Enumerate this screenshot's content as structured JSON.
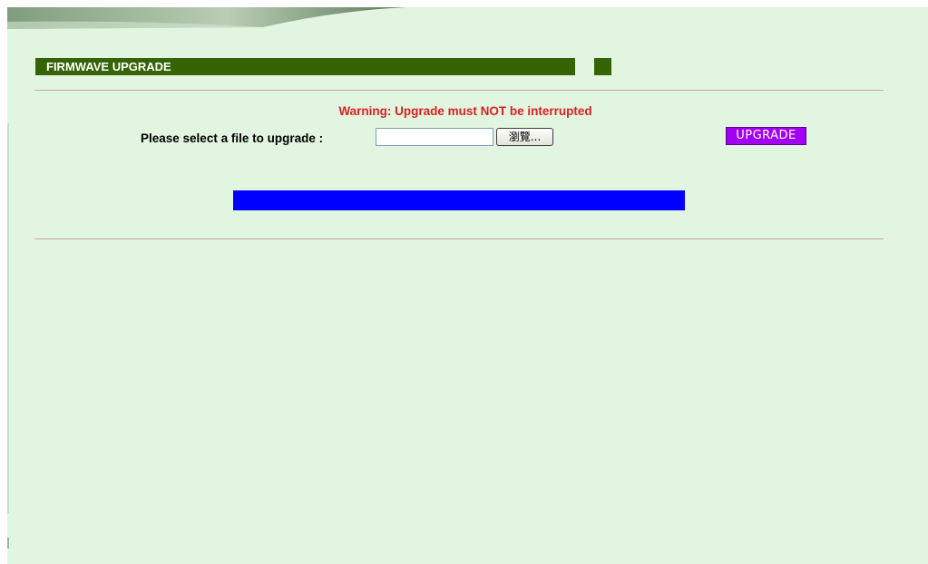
{
  "section": {
    "title": "FIRMWAVE UPGRADE"
  },
  "warning": {
    "text": "Warning: Upgrade must NOT be interrupted",
    "color": "#dd1f1f"
  },
  "file_select": {
    "label": "Please select a file to upgrade :",
    "input_value": "",
    "browse_label": "瀏覽..."
  },
  "upgrade_button": {
    "label": "UPGRADE",
    "color": "#a200f2"
  },
  "progress": {
    "fraction": 1.0,
    "color": "#0000ff"
  },
  "colors": {
    "background": "#e2f5e1",
    "title_bar": "#366404",
    "divider": "#c8a39c"
  }
}
